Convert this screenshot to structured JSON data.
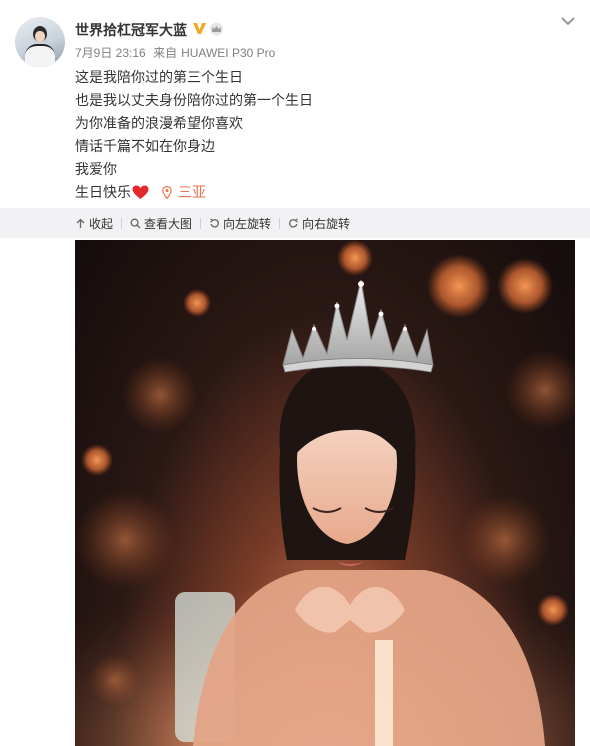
{
  "post": {
    "user_name": "世界拾杠冠军大蓝",
    "date": "7月9日 23:16",
    "source_prefix": "来自",
    "source": "HUAWEI P30 Pro",
    "lines": [
      "这是我陪你过的第三个生日",
      "也是我以丈夫身份陪你过的第一个生日",
      "为你准备的浪漫希望你喜欢",
      "情话千篇不如在你身边",
      "我爱你"
    ],
    "last_line": "生日快乐",
    "location": "三亚"
  },
  "media_toolbar": {
    "collapse_label": "收起",
    "view_large_label": "查看大图",
    "rotate_left_label": "向左旋转",
    "rotate_right_label": "向右旋转"
  },
  "icons": {
    "verified": "verified-v-icon",
    "badge": "crown-badge-icon",
    "more": "chevron-down-icon",
    "heart": "red-heart-icon",
    "location": "location-pin-icon"
  },
  "colors": {
    "verified": "#f5a623",
    "location_link": "#eb7350",
    "heart": "#e0282e",
    "toolbar_bg": "#f2f2f5"
  }
}
